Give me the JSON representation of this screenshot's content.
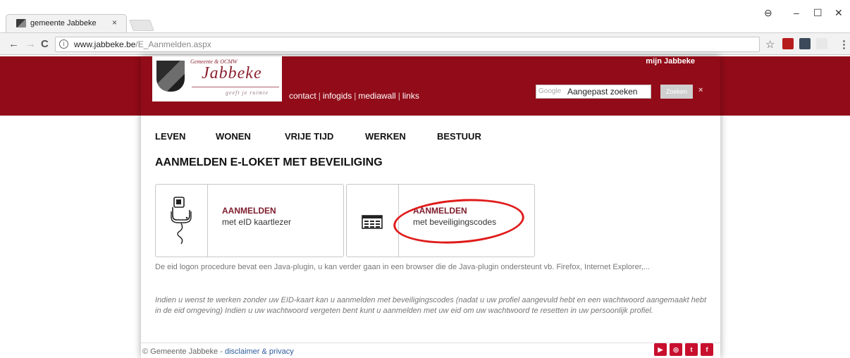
{
  "browser": {
    "tab_title": "gemeente Jabbeke",
    "tab_close": "×",
    "url_host": "www.jabbeke.be",
    "url_path": "/E_Aanmelden.aspx",
    "nav_back": "←",
    "nav_forward": "→",
    "nav_reload": "C",
    "info_icon": "i",
    "bookmark_star": "☆",
    "menu_dots": "⋮",
    "win_profile": "⊖",
    "win_minimize": "–",
    "win_maximize": "☐",
    "win_close": "✕"
  },
  "site": {
    "logo": {
      "subtitle": "Gemeente & OCMW",
      "name": "Jabbeke",
      "tagline": "geeft je ruimte"
    },
    "top_links": [
      "contact",
      "infogids",
      "mediawall",
      "links"
    ],
    "link_separator": "|",
    "mijn": "mijn Jabbeke",
    "search": {
      "google_label": "Google",
      "placeholder": "Aangepast zoeken",
      "button": "Zoeken",
      "clear": "×"
    },
    "main_nav": [
      "LEVEN",
      "WONEN",
      "VRIJE TIJD",
      "WERKEN",
      "BESTUUR"
    ],
    "page_title": "AANMELDEN E-LOKET MET BEVEILIGING",
    "cards": [
      {
        "title": "AANMELDEN",
        "subtitle": "met eID kaartlezer",
        "icon": "card-reader-icon"
      },
      {
        "title": "AANMELDEN",
        "subtitle": "met beveiligingscodes",
        "icon": "security-codes-icon"
      }
    ],
    "info1": "De eid logon procedure bevat een Java-plugin, u kan verder gaan in een browser die de Java-plugin ondersteunt vb. Firefox, Internet Explorer,...",
    "info2": "Indien u wenst te werken zonder uw EID-kaart kan u aanmelden met beveiligingscodes (nadat u uw profiel aangevuld hebt en een wachtwoord aangemaakt hebt in de eid omgeving) Indien u uw wachtwoord vergeten bent kunt u aanmelden met uw eid om uw wachtwoord te resetten in uw persoonlijk profiel.",
    "footer": {
      "copyright": "© Gemeente Jabbeke - ",
      "link": "disclaimer & privacy"
    },
    "social": [
      "youtube-icon",
      "instagram-icon",
      "twitter-icon",
      "facebook-icon"
    ],
    "social_glyphs": [
      "You\nTube",
      "◎",
      "t",
      "f"
    ]
  },
  "colors": {
    "brand_red": "#920b18",
    "title_red": "#7d1c2c",
    "annotation_red": "#e01b1b"
  }
}
